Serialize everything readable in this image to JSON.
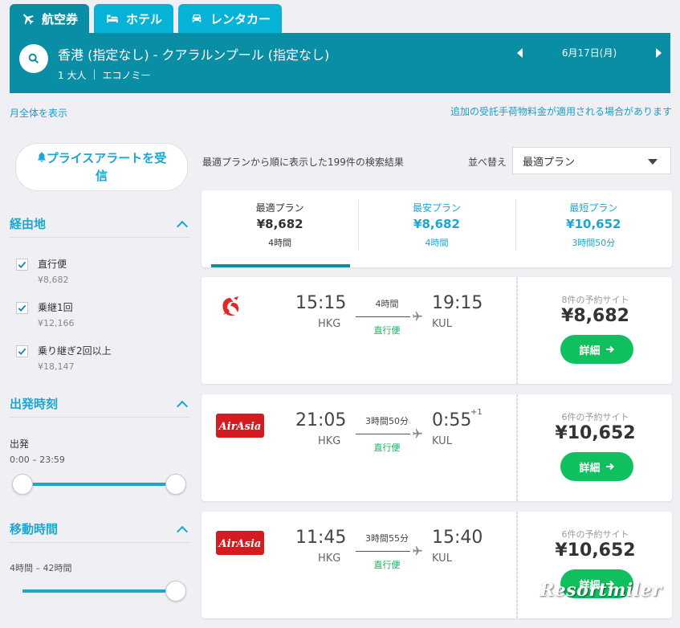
{
  "tabs": [
    {
      "label": "航空券",
      "icon": "plane-icon",
      "active": true
    },
    {
      "label": "ホテル",
      "icon": "bed-icon",
      "active": false
    },
    {
      "label": "レンタカー",
      "icon": "car-icon",
      "active": false
    }
  ],
  "search": {
    "route": "香港 (指定なし) - クアラルンプール (指定なし)",
    "passengers": "1 大人",
    "cabin": "エコノミー",
    "date": "6月17日(月)"
  },
  "links": {
    "month_view": "月全体を表示",
    "baggage_note": "追加の受託手荷物料金が適用される場合があります"
  },
  "sidebar": {
    "price_alert": "プライスアラートを受信",
    "stops": {
      "title": "経由地",
      "items": [
        {
          "label": "直行便",
          "price": "¥8,682",
          "checked": true
        },
        {
          "label": "乗継1回",
          "price": "¥12,166",
          "checked": true
        },
        {
          "label": "乗り継ぎ2回以上",
          "price": "¥18,147",
          "checked": true
        }
      ]
    },
    "departure": {
      "title": "出発時刻",
      "label": "出発",
      "range": "0:00 – 23:59"
    },
    "duration": {
      "title": "移動時間",
      "range": "4時間 – 42時間"
    }
  },
  "results": {
    "count_text": "最適プランから順に表示した199件の検索結果",
    "sort_label": "並べ替え",
    "sort_value": "最適プラン"
  },
  "summary": [
    {
      "title": "最適プラン",
      "price": "¥8,682",
      "duration": "4時間"
    },
    {
      "title": "最安プラン",
      "price": "¥8,682",
      "duration": "4時間"
    },
    {
      "title": "最短プラン",
      "price": "¥10,652",
      "duration": "3時間50分"
    }
  ],
  "flights": [
    {
      "airline_logo": "lion-air-logo",
      "dep_time": "15:15",
      "dep_code": "HKG",
      "duration": "4時間",
      "type": "直行便",
      "arr_time": "19:15",
      "arr_code": "KUL",
      "day_offset": "",
      "sites": "8件の予約サイト",
      "price": "¥8,682",
      "button": "詳細"
    },
    {
      "airline_logo": "airasia-logo",
      "logo_text": "AirAsia",
      "dep_time": "21:05",
      "dep_code": "HKG",
      "duration": "3時間50分",
      "type": "直行便",
      "arr_time": "0:55",
      "arr_code": "KUL",
      "day_offset": "+1",
      "sites": "6件の予約サイト",
      "price": "¥10,652",
      "button": "詳細"
    },
    {
      "airline_logo": "airasia-logo",
      "logo_text": "AirAsia",
      "dep_time": "11:45",
      "dep_code": "HKG",
      "duration": "3時間55分",
      "type": "直行便",
      "arr_time": "15:40",
      "arr_code": "KUL",
      "day_offset": "",
      "sites": "6件の予約サイト",
      "price": "¥10,652",
      "button": "詳細"
    }
  ],
  "watermark": "Resortmiler",
  "colors": {
    "header": "#0a8ea5",
    "tab_inactive": "#06b3d6",
    "accent": "#1ba7d0",
    "green": "#10c05e",
    "background": "#f0eff3"
  }
}
